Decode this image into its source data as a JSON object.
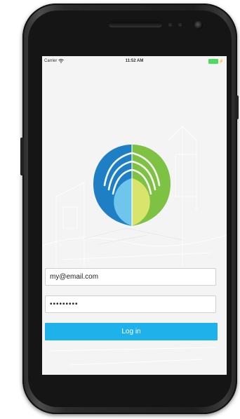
{
  "status_bar": {
    "carrier": "Carrier",
    "time": "11:52 AM",
    "wifi_icon": "wifi-icon",
    "battery_icon": "battery-icon"
  },
  "logo": {
    "icon": "app-logo-icon",
    "colors": {
      "blue_dark": "#1f7fc4",
      "blue_light": "#6ec6ec",
      "green": "#7dc242",
      "yellow": "#d8e46b"
    }
  },
  "login": {
    "email_value": "my@email.com",
    "password_value": "•••••••••",
    "button_label": "Log in"
  },
  "colors": {
    "accent": "#1fb1ea",
    "screen_background": "#f4f4f4",
    "phone_body": "#222222"
  }
}
